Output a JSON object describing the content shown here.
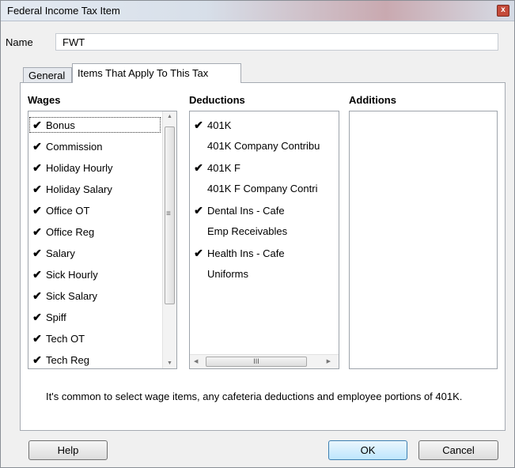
{
  "window": {
    "title": "Federal Income Tax Item",
    "close_glyph": "x"
  },
  "name_field": {
    "label": "Name",
    "value": "FWT"
  },
  "tabs": [
    {
      "label": "General",
      "active": false
    },
    {
      "label": "Items That Apply To This Tax",
      "active": true
    }
  ],
  "wages": {
    "header": "Wages",
    "items": [
      {
        "label": "Bonus",
        "checked": true
      },
      {
        "label": "Commission",
        "checked": true
      },
      {
        "label": "Holiday Hourly",
        "checked": true
      },
      {
        "label": "Holiday Salary",
        "checked": true
      },
      {
        "label": "Office OT",
        "checked": true
      },
      {
        "label": "Office Reg",
        "checked": true
      },
      {
        "label": "Salary",
        "checked": true
      },
      {
        "label": "Sick Hourly",
        "checked": true
      },
      {
        "label": "Sick Salary",
        "checked": true
      },
      {
        "label": "Spiff",
        "checked": true
      },
      {
        "label": "Tech OT",
        "checked": true
      },
      {
        "label": "Tech Reg",
        "checked": true
      }
    ]
  },
  "deductions": {
    "header": "Deductions",
    "items": [
      {
        "label": "401K",
        "checked": true
      },
      {
        "label": "401K Company Contribu",
        "checked": false
      },
      {
        "label": "401K F",
        "checked": true
      },
      {
        "label": "401K F Company Contri",
        "checked": false
      },
      {
        "label": "Dental Ins - Cafe",
        "checked": true
      },
      {
        "label": "Emp Receivables",
        "checked": false
      },
      {
        "label": "Health Ins - Cafe",
        "checked": true
      },
      {
        "label": "Uniforms",
        "checked": false
      }
    ]
  },
  "additions": {
    "header": "Additions",
    "items": []
  },
  "check_glyph": "✔",
  "note": "It's common to select wage items, any cafeteria deductions and employee portions of 401K.",
  "buttons": {
    "help": "Help",
    "ok": "OK",
    "cancel": "Cancel"
  },
  "scroll_glyphs": {
    "up": "▲",
    "down": "▼",
    "left": "◀",
    "right": "▶",
    "grip_v": "≡",
    "grip_h": "III"
  }
}
